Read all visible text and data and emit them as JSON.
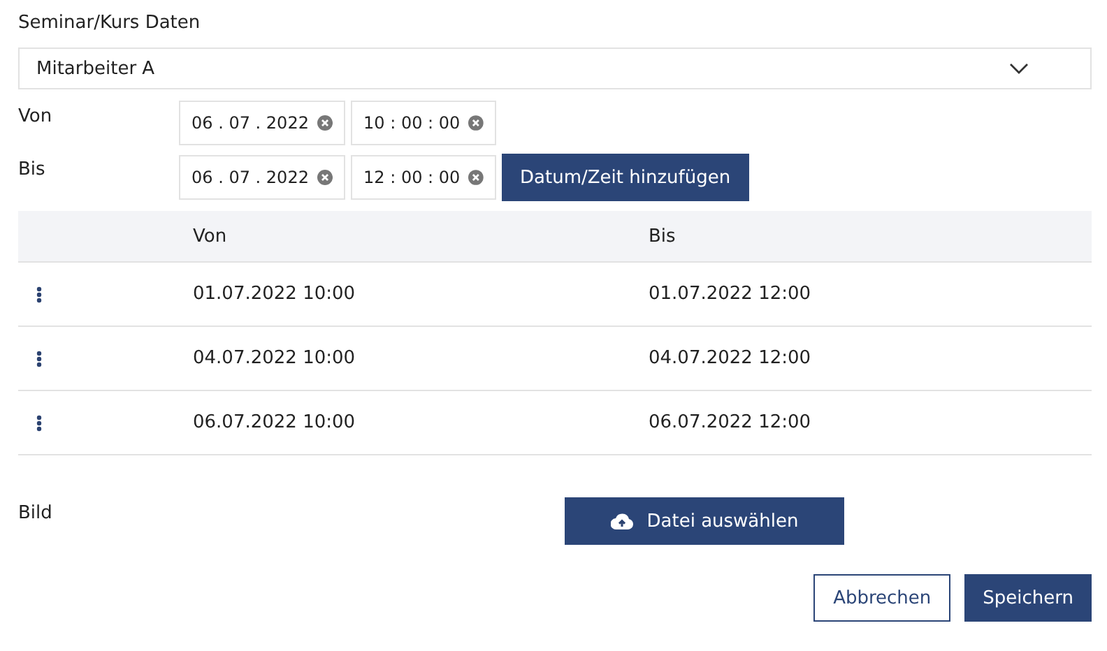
{
  "section_title": "Seminar/Kurs Daten",
  "employee_select": {
    "value": "Mitarbeiter A"
  },
  "time_rows": [
    {
      "label": "Von",
      "date": "06 . 07 . 2022",
      "time": "10 : 00 : 00"
    },
    {
      "label": "Bis",
      "date": "06 . 07 . 2022",
      "time": "12 : 00 : 00"
    }
  ],
  "add_button": "Datum/Zeit hinzufügen",
  "table": {
    "columns": [
      "Von",
      "Bis"
    ],
    "rows": [
      {
        "von": "01.07.2022 10:00",
        "bis": "01.07.2022 12:00"
      },
      {
        "von": "04.07.2022 10:00",
        "bis": "04.07.2022 12:00"
      },
      {
        "von": "06.07.2022 10:00",
        "bis": "06.07.2022 12:00"
      }
    ]
  },
  "image_label": "Bild",
  "upload_button": "Datei auswählen",
  "buttons": [
    {
      "label": "Abbrechen",
      "kind": "secondary"
    },
    {
      "label": "Speichern",
      "kind": "primary"
    }
  ]
}
